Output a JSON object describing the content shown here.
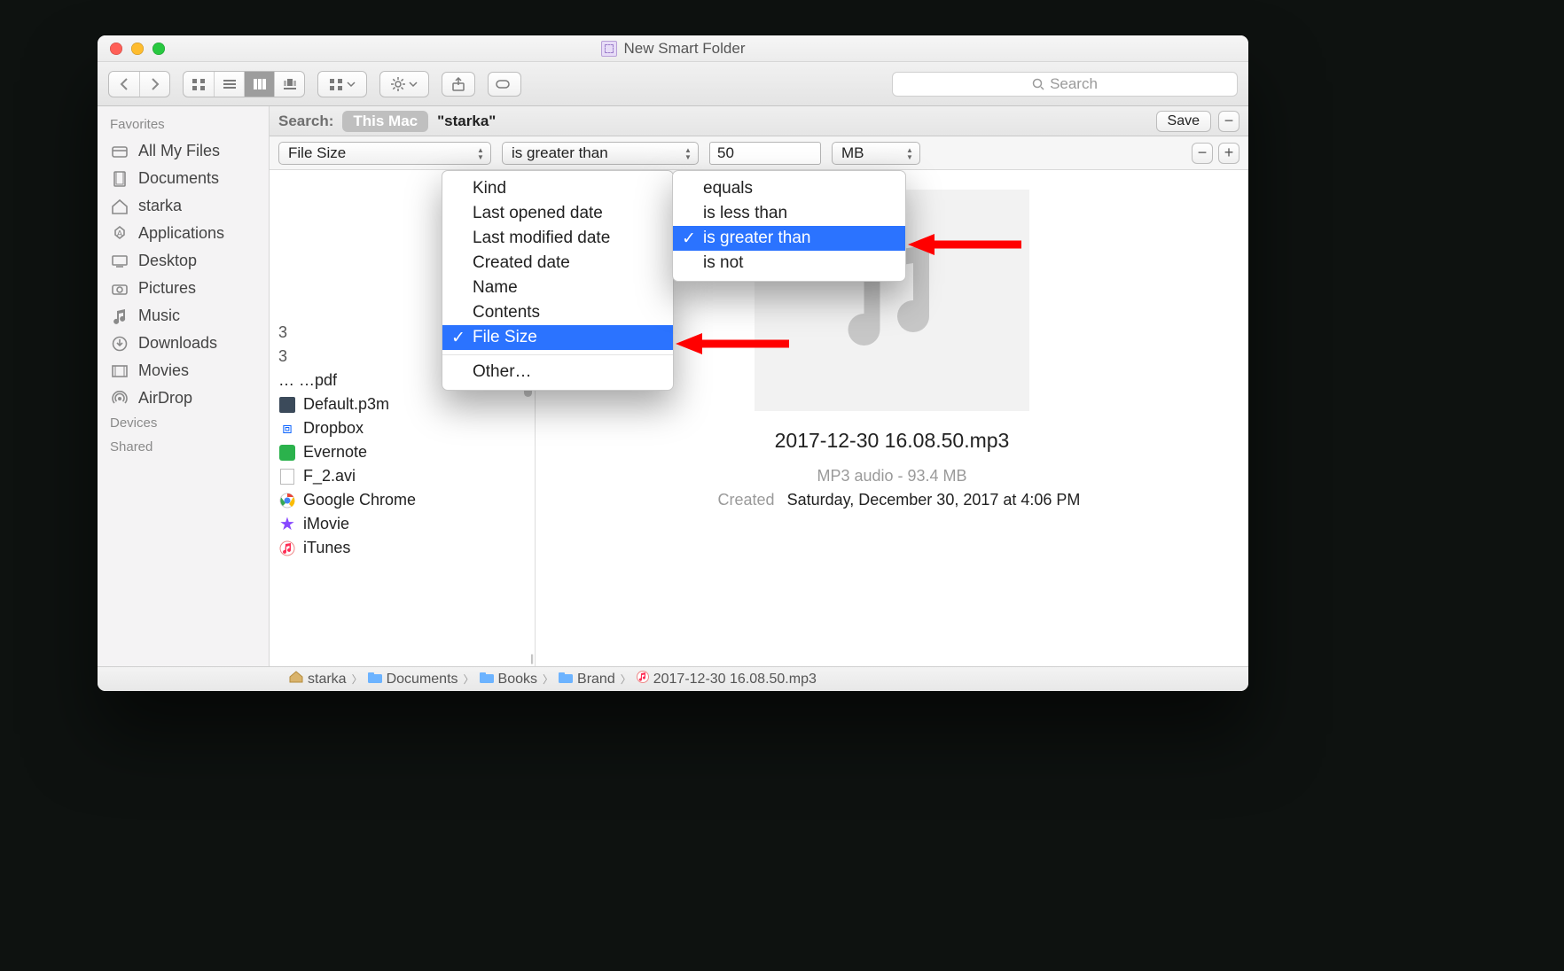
{
  "window": {
    "title": "New Smart Folder"
  },
  "toolbar": {
    "search_placeholder": "Search"
  },
  "sidebar": {
    "sections": {
      "favorites": "Favorites",
      "devices": "Devices",
      "shared": "Shared"
    },
    "items": [
      {
        "label": "All My Files",
        "icon": "all-files"
      },
      {
        "label": "Documents",
        "icon": "doc"
      },
      {
        "label": "starka",
        "icon": "home"
      },
      {
        "label": "Applications",
        "icon": "app"
      },
      {
        "label": "Desktop",
        "icon": "desktop"
      },
      {
        "label": "Pictures",
        "icon": "camera"
      },
      {
        "label": "Music",
        "icon": "music"
      },
      {
        "label": "Downloads",
        "icon": "download"
      },
      {
        "label": "Movies",
        "icon": "movie"
      },
      {
        "label": "AirDrop",
        "icon": "airdrop"
      }
    ]
  },
  "scopebar": {
    "label": "Search:",
    "this_mac": "This Mac",
    "folder": "\"starka\"",
    "save": "Save"
  },
  "criteria": {
    "attribute": "File Size",
    "operator": "is greater than",
    "value": "50",
    "unit": "MB"
  },
  "attribute_menu": [
    "Kind",
    "Last opened date",
    "Last modified date",
    "Created date",
    "Name",
    "Contents",
    "File Size"
  ],
  "attribute_menu_other": "Other…",
  "attribute_selected": "File Size",
  "operator_menu": [
    "equals",
    "is less than",
    "is greater than",
    "is not"
  ],
  "operator_selected": "is greater than",
  "results": [
    {
      "label": "Default.p3m",
      "icon": "cube"
    },
    {
      "label": "Dropbox",
      "icon": "dropbox"
    },
    {
      "label": "Evernote",
      "icon": "evernote"
    },
    {
      "label": "F_2.avi",
      "icon": "avi"
    },
    {
      "label": "Google Chrome",
      "icon": "chrome"
    },
    {
      "label": "iMovie",
      "icon": "imovie"
    },
    {
      "label": "iTunes",
      "icon": "itunes"
    }
  ],
  "preview": {
    "filename": "2017-12-30 16.08.50.mp3",
    "kind_size": "MP3 audio - 93.4 MB",
    "created_label": "Created",
    "created_value": "Saturday, December 30, 2017 at 4:06 PM"
  },
  "path": [
    "starka",
    "Documents",
    "Books",
    "Brand",
    "2017-12-30 16.08.50.mp3"
  ]
}
